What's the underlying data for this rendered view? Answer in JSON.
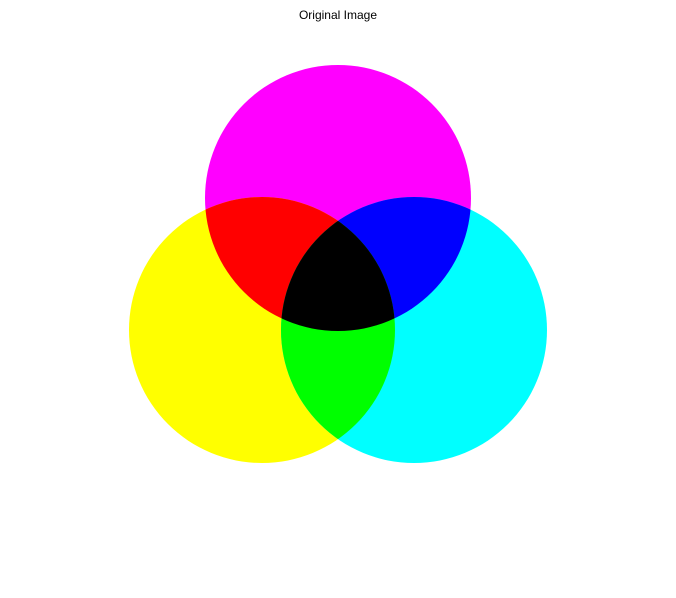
{
  "figure": {
    "title": "Original Image"
  },
  "circles": {
    "magenta": "#FF00FF",
    "yellow": "#FFFF00",
    "cyan": "#00FFFF"
  },
  "overlaps": {
    "magenta_yellow": "#FF0000",
    "magenta_cyan": "#0000FF",
    "yellow_cyan": "#00FF00",
    "all_three": "#000000"
  },
  "background": "#FFFFFF"
}
